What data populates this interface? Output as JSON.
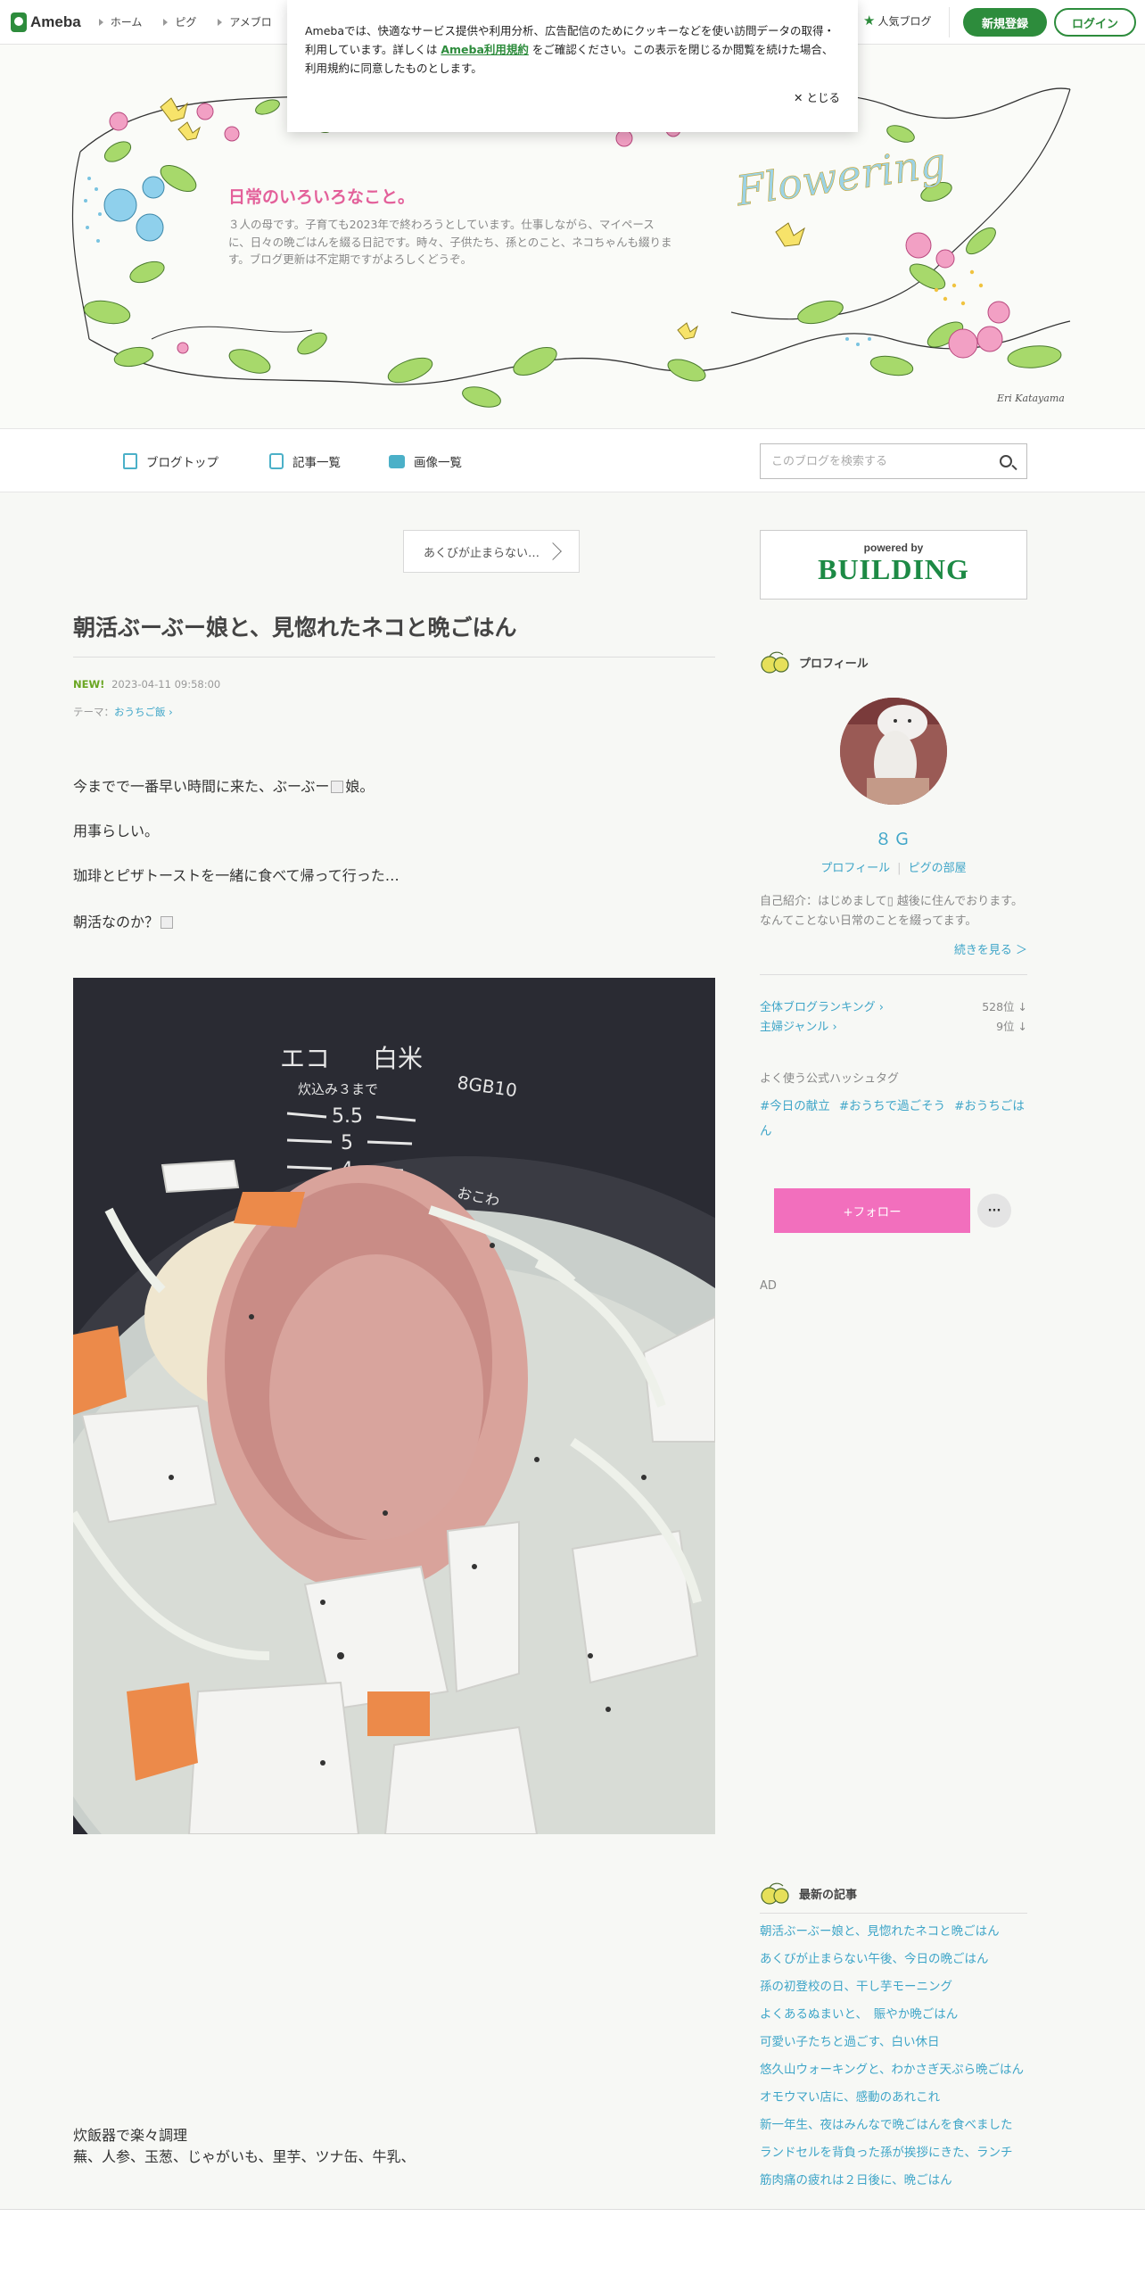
{
  "topbar": {
    "logo": "Ameba",
    "nav": [
      "ホーム",
      "ピグ",
      "アメブロ"
    ],
    "popular": "人気ブログ",
    "register": "新規登録",
    "login": "ログイン"
  },
  "cookie": {
    "text_before": "Amebaでは、快適なサービス提供や利用分析、広告配信のためにクッキーなどを使い訪問データの取得・利用しています。詳しくは ",
    "terms_link": "Ameba利用規約",
    "text_after": " をご確認ください。この表示を閉じるか閲覧を続けた場合、利用規約に同意したものとします。",
    "close": "とじる"
  },
  "header": {
    "title": "日常のいろいろなこと。",
    "description": "３人の母です。子育ても2023年で終わろうとしています。仕事しながら、マイペースに、日々の晩ごはんを綴る日記です。時々、子供たち、孫とのこと、ネコちゃんも綴ります。ブログ更新は不定期ですがよろしくどうぞ。",
    "signature": "Eri Katayama",
    "script_word": "Flowering"
  },
  "blog_nav": {
    "items": [
      "ブログトップ",
      "記事一覧",
      "画像一覧"
    ],
    "search_placeholder": "このブログを検索する"
  },
  "entry": {
    "prev_link": "あくびが止まらない…",
    "title": "朝活ぶーぶー娘と、見惚れたネコと晩ごはん",
    "new_label": "NEW!",
    "datetime": "2023-04-11 09:58:00",
    "theme_label": "テーマ：",
    "theme": "おうちご飯",
    "p1_before": "今までで一番早い時間に来た、ぶーぶー",
    "p1_after": "娘。",
    "p2": "用事らしい。",
    "p3": "珈琲とピザトーストを一緒に食べて帰って行った…",
    "p4": "朝活なのか？",
    "photo_texts": {
      "eco": "エコ",
      "rice": "白米",
      "model": "8GB10",
      "scale": "炊込み３まで",
      "n55": "5.5",
      "n5": "5",
      "n4": "4",
      "owakoge": "おこわ"
    },
    "footer_line1": "炊飯器で楽々調理",
    "footer_line2": "蕪、人参、玉葱、じゃがいも、里芋、ツナ缶、牛乳、"
  },
  "sidebar": {
    "ad": {
      "powered": "powered by",
      "brand": "BUILDING"
    },
    "profile_head": "プロフィール",
    "nickname": "８Ｇ",
    "profile_link": "プロフィール",
    "pig_link": "ピグの部屋",
    "intro": "自己紹介：はじめまして▯ 越後に住んでおります。 なんてことない日常のことを綴ってます。",
    "more": "続きを見る ＞",
    "ranking": [
      {
        "label": "全体ブログランキング",
        "value": "528位 ↓"
      },
      {
        "label": "主婦ジャンル",
        "value": "9位 ↓"
      }
    ],
    "hashtag_head": "よく使う公式ハッシュタグ",
    "hashtags": [
      "#今日の献立",
      "#おうちで過ごそう",
      "#おうちごはん"
    ],
    "follow": "+フォロー",
    "dots": "···",
    "ad_label": "AD",
    "recent_head": "最新の記事",
    "recent": [
      "朝活ぶーぶー娘と、見惚れたネコと晩ごはん",
      "あくびが止まらない午後、今日の晩ごはん",
      "孫の初登校の日、干し芋モーニング",
      "よくあるぬまいと、　賑やか晩ごはん",
      "可愛い子たちと過ごす、白い休日",
      "悠久山ウォーキングと、わかさぎ天ぷら晩ごはん",
      "オモウマい店に、感動のあれこれ",
      "新一年生、夜はみんなで晩ごはんを食べました",
      "ランドセルを背負った孫が挨拶にきた、ランチ",
      "筋肉痛の疲れは２日後に、晩ごはん"
    ]
  },
  "colors": {
    "brand_green": "#2d8c3c",
    "link_blue": "#3ea5c8",
    "title_pink": "#e3609a",
    "follow_pink": "#f26fbd"
  }
}
